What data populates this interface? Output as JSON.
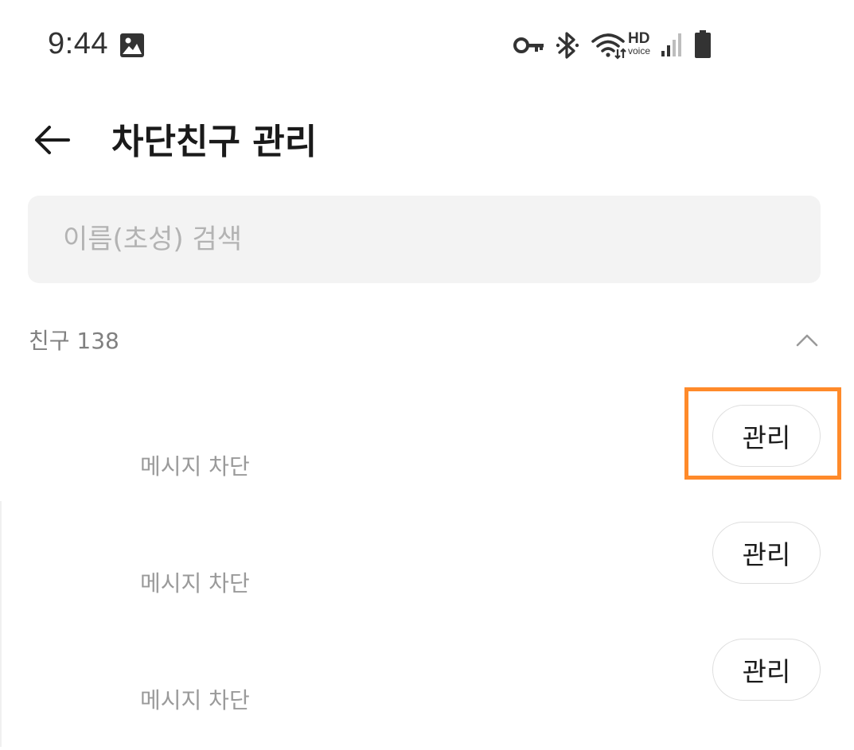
{
  "status_bar": {
    "time": "9:44",
    "hd_label": "HD",
    "voice_label": "voice",
    "icons": [
      "gallery-icon",
      "vpn-key-icon",
      "bluetooth-icon",
      "wifi-icon",
      "hd-voice-icon",
      "cellular-signal-icon",
      "battery-icon"
    ]
  },
  "header": {
    "title": "차단친구 관리",
    "back_icon": "back-arrow-icon"
  },
  "search": {
    "placeholder": "이름(초성) 검색",
    "value": ""
  },
  "section": {
    "label": "친구 138",
    "toggle_icon": "chevron-up-icon"
  },
  "friends": [
    {
      "name": "",
      "status": "메시지 차단",
      "action_label": "관리"
    },
    {
      "name": "",
      "status": "메시지 차단",
      "action_label": "관리"
    },
    {
      "name": "",
      "status": "메시지 차단",
      "action_label": "관리"
    }
  ],
  "colors": {
    "highlight": "#ff8a2a",
    "search_bg": "#f3f3f3",
    "secondary_text": "#9a9a9a"
  }
}
